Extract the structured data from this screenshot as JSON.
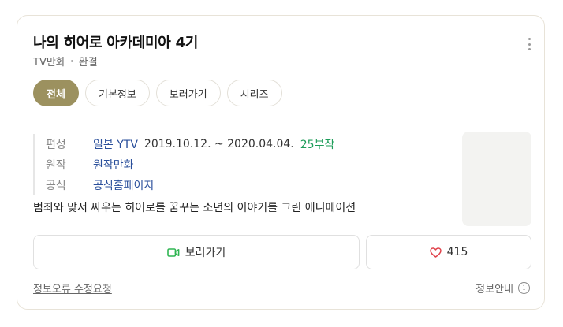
{
  "header": {
    "title": "나의 히어로 아카데미아 4기",
    "category": "TV만화",
    "status": "완결",
    "more_icon": "more-vertical-icon"
  },
  "tabs": [
    {
      "label": "전체",
      "active": true
    },
    {
      "label": "기본정보",
      "active": false
    },
    {
      "label": "보러가기",
      "active": false
    },
    {
      "label": "시리즈",
      "active": false
    }
  ],
  "info": {
    "broadcast": {
      "label": "편성",
      "channel": "일본 YTV",
      "period": "2019.10.12. ~ 2020.04.04.",
      "episodes": "25부작"
    },
    "original": {
      "label": "원작",
      "value": "원작만화"
    },
    "official": {
      "label": "공식",
      "value": "공식홈페이지"
    }
  },
  "description": "범죄와 맞서 싸우는 히어로를 꿈꾸는 소년의 이야기를 그린 애니메이션",
  "actions": {
    "watch_label": "보러가기",
    "watch_icon": "video-camera-icon",
    "like_count": "415",
    "like_icon": "heart-icon"
  },
  "footer": {
    "report_label": "정보오류 수정요청",
    "info_label": "정보안내",
    "info_icon": "info-circle-icon"
  },
  "colors": {
    "active_tab": "#9c915f",
    "link": "#2a4f9b",
    "episodes": "#1e9d5a",
    "watch_icon": "#2fb552",
    "heart_icon": "#e0414a"
  }
}
